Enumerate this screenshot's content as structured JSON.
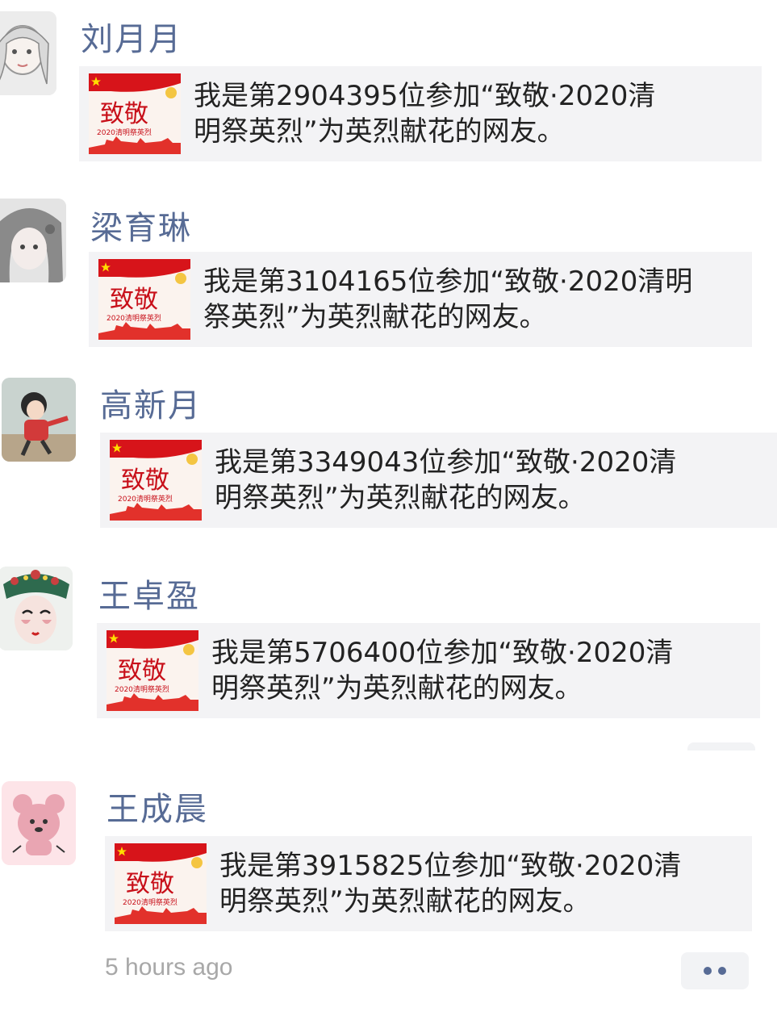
{
  "posts": [
    {
      "name": "刘月月",
      "line1": "我是第2904395位参加“致敬·2020清",
      "line2": "明祭英烈”为英烈献花的网友。"
    },
    {
      "name": "梁育琳",
      "line1": "我是第3104165位参加“致敬·2020清明",
      "line2": "祭英烈”为英烈献花的网友。"
    },
    {
      "name": "高新月",
      "line1": "我是第3349043位参加“致敬·2020清",
      "line2": "明祭英烈”为英烈献花的网友。"
    },
    {
      "name": "王卓盈",
      "line1": "我是第5706400位参加“致敬·2020清",
      "line2": "明祭英烈”为英烈献花的网友。"
    },
    {
      "name": "王成晨",
      "line1": "我是第3915825位参加“致敬·2020清",
      "line2": "明祭英烈”为英烈献花的网友。"
    }
  ],
  "thumbnail": {
    "title": "致敬",
    "subtitle": "2020清明祭英烈"
  },
  "timestamp": "5 hours ago",
  "colors": {
    "name_link": "#576b95",
    "card_bg": "#f3f3f5",
    "flag_red": "#d7141a"
  }
}
